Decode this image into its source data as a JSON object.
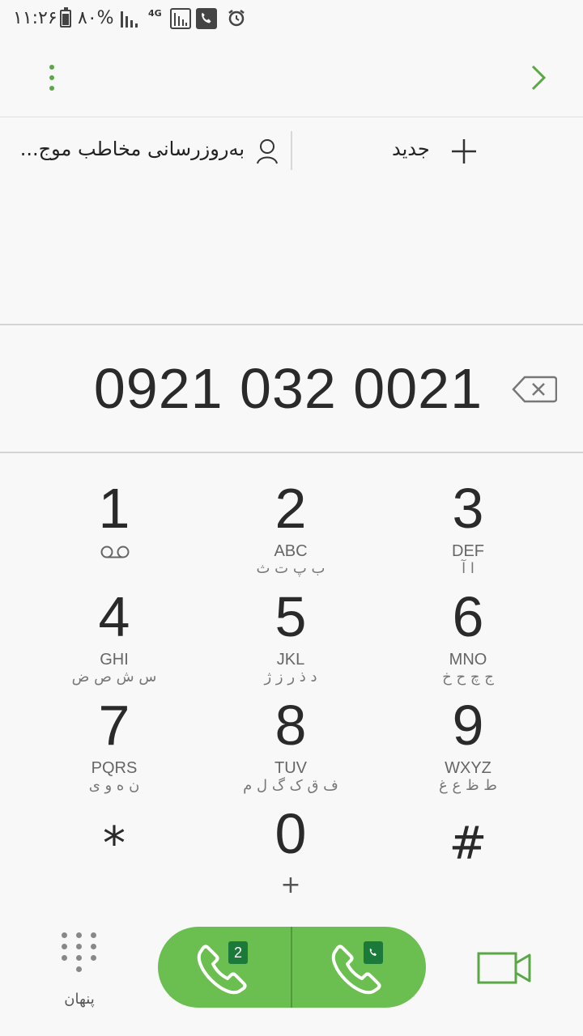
{
  "status_bar": {
    "time": "۱۱:۲۶",
    "battery": "۸۰%",
    "network": "4G"
  },
  "actions": {
    "update_contact": "بەروزرسانی مخاطب موج...",
    "new_contact": "جدید"
  },
  "dialer": {
    "number": "0921 032 0021"
  },
  "keypad": [
    {
      "digit": "1",
      "letters": "",
      "arabic": ""
    },
    {
      "digit": "2",
      "letters": "ABC",
      "arabic": "ب پ ت ث"
    },
    {
      "digit": "3",
      "letters": "DEF",
      "arabic": "ا آ"
    },
    {
      "digit": "4",
      "letters": "GHI",
      "arabic": "س ش ص ض"
    },
    {
      "digit": "5",
      "letters": "JKL",
      "arabic": "د ذ ر ز ژ"
    },
    {
      "digit": "6",
      "letters": "MNO",
      "arabic": "ج چ ح خ"
    },
    {
      "digit": "7",
      "letters": "PQRS",
      "arabic": "ن ه و ی"
    },
    {
      "digit": "8",
      "letters": "TUV",
      "arabic": "ف ق ک گ ل م"
    },
    {
      "digit": "9",
      "letters": "WXYZ",
      "arabic": "ط ظ ع غ"
    },
    {
      "digit": "0",
      "letters": "+",
      "arabic": ""
    }
  ],
  "keypad_symbols": {
    "star": "*",
    "hash": "#"
  },
  "bottom": {
    "hide_label": "پنهان",
    "sim2_badge": "2"
  },
  "colors": {
    "accent": "#5aa845",
    "call_button": "#6abf50"
  }
}
